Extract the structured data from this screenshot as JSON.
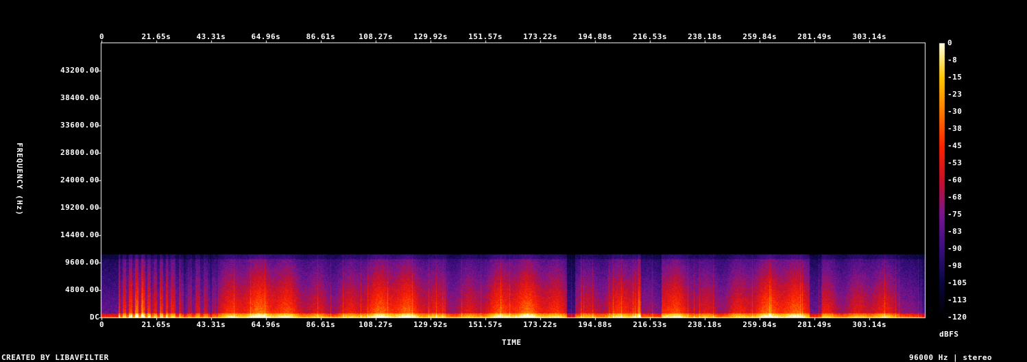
{
  "footer": {
    "created_by": "CREATED BY LIBAVFILTER",
    "format": "96000 Hz | stereo"
  },
  "chart_data": {
    "type": "heatmap",
    "title": "",
    "xlabel": "TIME",
    "ylabel": "FREQUENCY (Hz)",
    "colorbar_label": "dBFS",
    "x_ticks": [
      "0",
      "21.65s",
      "43.31s",
      "64.96s",
      "86.61s",
      "108.27s",
      "129.92s",
      "151.57s",
      "173.22s",
      "194.88s",
      "216.53s",
      "238.18s",
      "259.84s",
      "281.49s",
      "303.14s"
    ],
    "x_tick_values": [
      0,
      21.65,
      43.31,
      64.96,
      86.61,
      108.27,
      129.92,
      151.57,
      173.22,
      194.88,
      216.53,
      238.18,
      259.84,
      281.49,
      303.14
    ],
    "xlim": [
      0,
      325
    ],
    "y_ticks": [
      "DC",
      "4800.00",
      "9600.00",
      "14400.00",
      "19200.00",
      "24000.00",
      "28800.00",
      "33600.00",
      "38400.00",
      "43200.00"
    ],
    "y_tick_values": [
      0,
      4800,
      9600,
      14400,
      19200,
      24000,
      28800,
      33600,
      38400,
      43200
    ],
    "ylim": [
      0,
      48000
    ],
    "colorbar_ticks": [
      "0",
      "-8",
      "-15",
      "-23",
      "-30",
      "-38",
      "-45",
      "-53",
      "-60",
      "-68",
      "-75",
      "-83",
      "-90",
      "-98",
      "-105",
      "-113",
      "-120"
    ],
    "colorbar_range": [
      -120,
      0
    ],
    "content_cutoff_hz": 11000,
    "colors": {
      "background": "#000000",
      "axis": "#ffffff"
    },
    "colormap": [
      "#000000",
      "#0a0640",
      "#3a0f80",
      "#7a1590",
      "#c8102a",
      "#ff2200",
      "#ff7a00",
      "#ffc800",
      "#ffffe0"
    ]
  }
}
